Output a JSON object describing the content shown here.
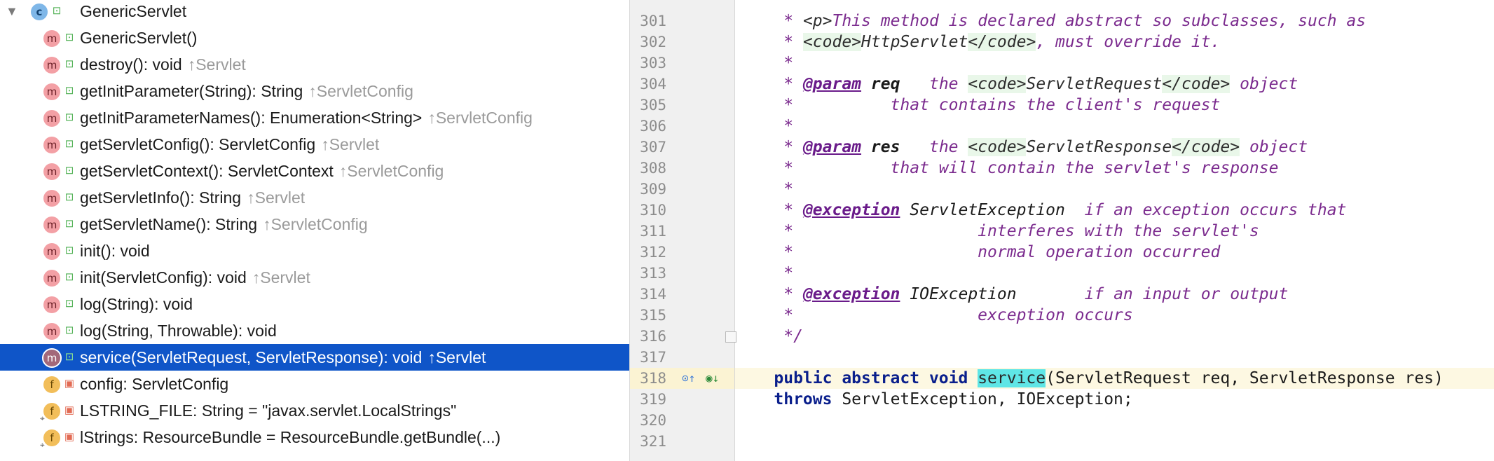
{
  "structure": {
    "root": {
      "label": "GenericServlet",
      "kind": "c"
    },
    "members": [
      {
        "kind": "m",
        "vis": "public",
        "sig": "GenericServlet()",
        "inherit": ""
      },
      {
        "kind": "m",
        "vis": "public",
        "sig": "destroy(): void",
        "inherit": "↑Servlet"
      },
      {
        "kind": "m",
        "vis": "public",
        "sig": "getInitParameter(String): String",
        "inherit": "↑ServletConfig"
      },
      {
        "kind": "m",
        "vis": "public",
        "sig": "getInitParameterNames(): Enumeration<String>",
        "inherit": "↑ServletConfig"
      },
      {
        "kind": "m",
        "vis": "public",
        "sig": "getServletConfig(): ServletConfig",
        "inherit": "↑Servlet"
      },
      {
        "kind": "m",
        "vis": "public",
        "sig": "getServletContext(): ServletContext",
        "inherit": "↑ServletConfig"
      },
      {
        "kind": "m",
        "vis": "public",
        "sig": "getServletInfo(): String",
        "inherit": "↑Servlet"
      },
      {
        "kind": "m",
        "vis": "public",
        "sig": "getServletName(): String",
        "inherit": "↑ServletConfig"
      },
      {
        "kind": "m",
        "vis": "public",
        "sig": "init(): void",
        "inherit": ""
      },
      {
        "kind": "m",
        "vis": "public",
        "sig": "init(ServletConfig): void",
        "inherit": "↑Servlet"
      },
      {
        "kind": "m",
        "vis": "public",
        "sig": "log(String): void",
        "inherit": ""
      },
      {
        "kind": "m",
        "vis": "public",
        "sig": "log(String, Throwable): void",
        "inherit": ""
      },
      {
        "kind": "m",
        "vis": "public",
        "sig": "service(ServletRequest, ServletResponse): void",
        "inherit": "↑Servlet",
        "selected": true
      },
      {
        "kind": "f",
        "vis": "private",
        "sig": "config: ServletConfig",
        "inherit": ""
      },
      {
        "kind": "f",
        "vis": "private",
        "static": true,
        "sig": "LSTRING_FILE: String = \"javax.servlet.LocalStrings\"",
        "inherit": ""
      },
      {
        "kind": "f",
        "vis": "private",
        "static": true,
        "sig": "lStrings: ResourceBundle = ResourceBundle.getBundle(...)",
        "inherit": ""
      }
    ]
  },
  "editor": {
    "lines": [
      {
        "n": "301",
        "segs": [
          [
            "cm",
            "     * "
          ],
          [
            "tagk",
            "<p>"
          ],
          [
            "cm",
            "This method is declared abstract so subclasses, such as"
          ]
        ]
      },
      {
        "n": "302",
        "segs": [
          [
            "cm",
            "     * "
          ],
          [
            "tag",
            "<code>"
          ],
          [
            "tagk",
            "HttpServlet"
          ],
          [
            "tag",
            "</code>"
          ],
          [
            "cm",
            ", must override it."
          ]
        ]
      },
      {
        "n": "303",
        "segs": [
          [
            "cm",
            "     *"
          ]
        ]
      },
      {
        "n": "304",
        "segs": [
          [
            "cm",
            "     * "
          ],
          [
            "doctag",
            "@param"
          ],
          [
            "cm",
            " "
          ],
          [
            "docarg",
            "req"
          ],
          [
            "cm",
            "   the "
          ],
          [
            "tag",
            "<code>"
          ],
          [
            "tagk",
            "ServletRequest"
          ],
          [
            "tag",
            "</code>"
          ],
          [
            "cm",
            " object"
          ]
        ]
      },
      {
        "n": "305",
        "segs": [
          [
            "cm",
            "     *          that contains the client's request"
          ]
        ]
      },
      {
        "n": "306",
        "segs": [
          [
            "cm",
            "     *"
          ]
        ]
      },
      {
        "n": "307",
        "segs": [
          [
            "cm",
            "     * "
          ],
          [
            "doctag",
            "@param"
          ],
          [
            "cm",
            " "
          ],
          [
            "docarg",
            "res"
          ],
          [
            "cm",
            "   the "
          ],
          [
            "tag",
            "<code>"
          ],
          [
            "tagk",
            "ServletResponse"
          ],
          [
            "tag",
            "</code>"
          ],
          [
            "cm",
            " object"
          ]
        ]
      },
      {
        "n": "308",
        "segs": [
          [
            "cm",
            "     *          that will contain the servlet's response"
          ]
        ]
      },
      {
        "n": "309",
        "segs": [
          [
            "cm",
            "     *"
          ]
        ]
      },
      {
        "n": "310",
        "segs": [
          [
            "cm",
            "     * "
          ],
          [
            "doctag",
            "@exception"
          ],
          [
            "cm",
            " "
          ],
          [
            "exname",
            "ServletException"
          ],
          [
            "cm",
            "  if an exception occurs that"
          ]
        ]
      },
      {
        "n": "311",
        "segs": [
          [
            "cm",
            "     *                   interferes with the servlet's"
          ]
        ]
      },
      {
        "n": "312",
        "segs": [
          [
            "cm",
            "     *                   normal operation occurred"
          ]
        ]
      },
      {
        "n": "313",
        "segs": [
          [
            "cm",
            "     *"
          ]
        ]
      },
      {
        "n": "314",
        "segs": [
          [
            "cm",
            "     * "
          ],
          [
            "doctag",
            "@exception"
          ],
          [
            "cm",
            " "
          ],
          [
            "exname",
            "IOException"
          ],
          [
            "cm",
            "       if an input or output"
          ]
        ]
      },
      {
        "n": "315",
        "segs": [
          [
            "cm",
            "     *                   exception occurs"
          ]
        ]
      },
      {
        "n": "316",
        "segs": [
          [
            "cm",
            "     */"
          ]
        ]
      },
      {
        "n": "317",
        "segs": []
      },
      {
        "n": "318",
        "current": true,
        "segs": [
          [
            "kw",
            "    public abstract void "
          ],
          [
            "hl",
            "service"
          ],
          [
            "plain",
            "(ServletRequest req, ServletResponse res)"
          ]
        ]
      },
      {
        "n": "319",
        "segs": [
          [
            "kw",
            "    throws "
          ],
          [
            "plain",
            "ServletException, IOException;"
          ]
        ]
      },
      {
        "n": "320",
        "segs": []
      },
      {
        "n": "321",
        "segs": []
      }
    ]
  },
  "colors": {
    "selection": "#0f55c8",
    "current_line": "#fdf8e2",
    "search_highlight": "#5fe6e6"
  },
  "icons": {
    "expand": "triangle-down-icon",
    "method": "method-m-icon",
    "field": "field-f-icon",
    "class": "class-c-icon"
  }
}
